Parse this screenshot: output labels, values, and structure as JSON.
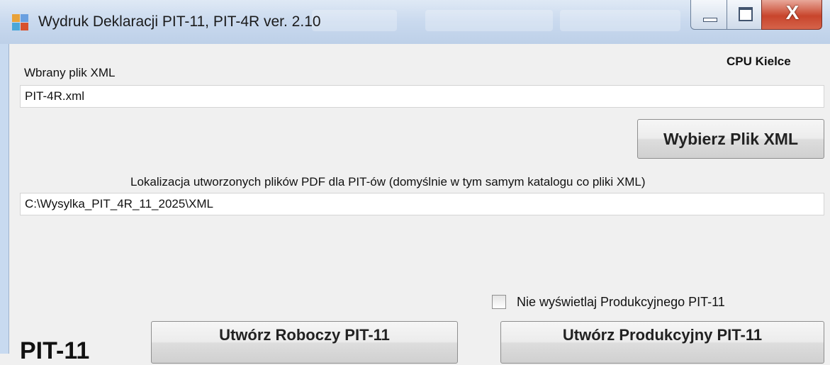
{
  "window": {
    "title": "Wydruk Deklaracji PIT-11, PIT-4R  ver. 2.10",
    "icon": "app-window-icon",
    "controls": {
      "minimize": "minimize-icon",
      "maximize": "maximize-icon",
      "close_glyph": "X"
    }
  },
  "header": {
    "org_label": "CPU  Kielce"
  },
  "xml_file": {
    "label": "Wbrany plik XML",
    "value": "PIT-4R.xml",
    "choose_button": "Wybierz Plik XML"
  },
  "pdf_location": {
    "label": "Lokalizacja utworzonych plików PDF dla PIT-ów (domyślnie w tym samym katalogu co pliki XML)",
    "value": "C:\\Wysylka_PIT_4R_11_2025\\XML"
  },
  "options": {
    "hide_production_label": "Nie wyświetlaj Produkcyjnego PIT-11",
    "hide_production_checked": false
  },
  "pit11": {
    "section_label": "PIT-11",
    "draft_button": "Utwórz Roboczy PIT-11",
    "production_button": "Utwórz Produkcyjny PIT-11"
  }
}
